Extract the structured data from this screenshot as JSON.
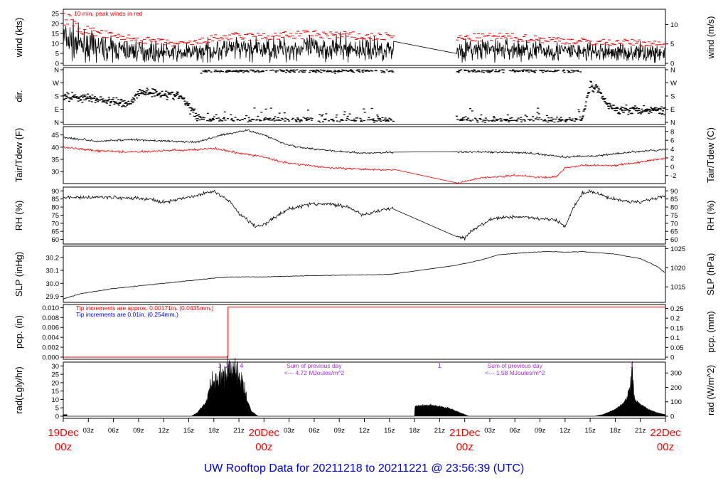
{
  "chart_data": [
    {
      "id": "wind",
      "type": "line",
      "ylabel": "wind (kts)",
      "ylabel_right": "wind (m/s)",
      "ylim": [
        0,
        26
      ],
      "yticks": [
        0,
        5,
        10,
        15,
        20,
        25
      ],
      "yticks_right": [
        0,
        5,
        10
      ],
      "right_scale": 0.5144,
      "annotation": "10 min. peak winds in red",
      "series_color": "#000000",
      "peak_color": "#ff0000",
      "gap_hours": [
        39.5,
        47
      ],
      "avg": [
        [
          0,
          12
        ],
        [
          1,
          11
        ],
        [
          2,
          9
        ],
        [
          4,
          8
        ],
        [
          6,
          7
        ],
        [
          8,
          6.5
        ],
        [
          10,
          6
        ],
        [
          12,
          5.5
        ],
        [
          14,
          5
        ],
        [
          16,
          5.5
        ],
        [
          18,
          6.5
        ],
        [
          20,
          7
        ],
        [
          24,
          7
        ],
        [
          28,
          7.5
        ],
        [
          32,
          7.5
        ],
        [
          36,
          7
        ],
        [
          39.5,
          7
        ],
        [
          47,
          6.5
        ],
        [
          52,
          7
        ],
        [
          56,
          6.5
        ],
        [
          60,
          6
        ],
        [
          64,
          5.5
        ],
        [
          68,
          5.5
        ],
        [
          72,
          5
        ]
      ]
    },
    {
      "id": "dir",
      "type": "scatter",
      "ylabel": "dir.",
      "ytick_labels": [
        "N",
        "E",
        "S",
        "W",
        "N"
      ],
      "ylim": [
        0,
        360
      ],
      "values": [
        [
          0,
          180
        ],
        [
          4,
          160
        ],
        [
          6,
          140
        ],
        [
          8,
          130
        ],
        [
          9,
          200
        ],
        [
          10,
          210
        ],
        [
          12,
          195
        ],
        [
          14,
          180
        ],
        [
          15,
          110
        ],
        [
          16,
          40
        ],
        [
          17,
          10
        ],
        [
          62,
          10
        ],
        [
          63,
          260
        ],
        [
          64,
          220
        ],
        [
          65,
          120
        ],
        [
          66,
          90
        ],
        [
          72,
          85
        ]
      ]
    },
    {
      "id": "temp",
      "type": "line",
      "ylabel": "Tair/Tdew (F)",
      "ylabel_right": "Tair/Tdew (C)",
      "ylim": [
        26,
        47.5
      ],
      "yticks": [
        30,
        35,
        40,
        45
      ],
      "yticks_right": [
        -2,
        0,
        2,
        4,
        6,
        8
      ],
      "series": [
        {
          "name": "Tair",
          "color": "#000000",
          "values": [
            [
              0,
              44
            ],
            [
              4,
              42.5
            ],
            [
              8,
              43
            ],
            [
              12,
              42.5
            ],
            [
              16,
              42
            ],
            [
              19,
              45
            ],
            [
              22,
              47
            ],
            [
              24,
              45
            ],
            [
              26,
              42
            ],
            [
              28,
              40
            ],
            [
              32,
              38.5
            ],
            [
              36,
              37.5
            ],
            [
              40,
              38
            ],
            [
              48,
              38
            ],
            [
              52,
              38
            ],
            [
              56,
              37.5
            ],
            [
              60,
              36
            ],
            [
              64,
              36.5
            ],
            [
              68,
              38
            ],
            [
              72,
              39
            ]
          ]
        },
        {
          "name": "Tdew",
          "color": "#ff0000",
          "values": [
            [
              0,
              40
            ],
            [
              4,
              38.5
            ],
            [
              8,
              38
            ],
            [
              12,
              38.5
            ],
            [
              16,
              39
            ],
            [
              18,
              39.5
            ],
            [
              21,
              37.5
            ],
            [
              24,
              36
            ],
            [
              26,
              34
            ],
            [
              28,
              33
            ],
            [
              32,
              31.5
            ],
            [
              36,
              31
            ],
            [
              40,
              30.5
            ],
            [
              44,
              30
            ],
            [
              45.5,
              28.5
            ],
            [
              47,
              25
            ],
            [
              48,
              26
            ],
            [
              50,
              27.5
            ],
            [
              54,
              28.5
            ],
            [
              58,
              27.5
            ],
            [
              59,
              28
            ],
            [
              60,
              31.5
            ],
            [
              62,
              32.5
            ],
            [
              66,
              32.5
            ],
            [
              68,
              33.5
            ],
            [
              72,
              35.5
            ]
          ]
        }
      ]
    },
    {
      "id": "rh",
      "type": "line",
      "ylabel": "RH (%)",
      "ylabel_right": "RH (%)",
      "ylim": [
        58.5,
        91
      ],
      "yticks": [
        60,
        65,
        70,
        75,
        80,
        85,
        90
      ],
      "values": [
        [
          0,
          86
        ],
        [
          6,
          86
        ],
        [
          10,
          85
        ],
        [
          12,
          83
        ],
        [
          16,
          87
        ],
        [
          18,
          90
        ],
        [
          20,
          83
        ],
        [
          21,
          76
        ],
        [
          22,
          72
        ],
        [
          23,
          68
        ],
        [
          24,
          69
        ],
        [
          25,
          73
        ],
        [
          27,
          79
        ],
        [
          30,
          82
        ],
        [
          32,
          82
        ],
        [
          34,
          80
        ],
        [
          36,
          75
        ],
        [
          38,
          78
        ],
        [
          40,
          80
        ],
        [
          42,
          78
        ],
        [
          45,
          76
        ],
        [
          46,
          72
        ],
        [
          47,
          62
        ],
        [
          48,
          61
        ],
        [
          49,
          66
        ],
        [
          51,
          72
        ],
        [
          53,
          74
        ],
        [
          55,
          74
        ],
        [
          57,
          73
        ],
        [
          59,
          72
        ],
        [
          60,
          68
        ],
        [
          61,
          80
        ],
        [
          62,
          88
        ],
        [
          63,
          90
        ],
        [
          65,
          86
        ],
        [
          67,
          84
        ],
        [
          69,
          83
        ],
        [
          72,
          87
        ]
      ]
    },
    {
      "id": "slp",
      "type": "line",
      "ylabel": "SLP (inHg)",
      "ylabel_right": "SLP (hPa)",
      "ylim": [
        29.87,
        30.27
      ],
      "yticks": [
        29.9,
        30.0,
        30.1,
        30.2
      ],
      "yticks_right": [
        1015,
        1020,
        1025
      ],
      "values": [
        [
          0,
          29.88
        ],
        [
          2,
          29.92
        ],
        [
          6,
          29.96
        ],
        [
          12,
          30.0
        ],
        [
          18,
          30.04
        ],
        [
          20,
          30.05
        ],
        [
          24,
          30.05
        ],
        [
          30,
          30.06
        ],
        [
          36,
          30.065
        ],
        [
          39.5,
          30.07
        ],
        [
          47,
          30.14
        ],
        [
          50,
          30.18
        ],
        [
          52,
          30.22
        ],
        [
          56,
          30.24
        ],
        [
          58,
          30.245
        ],
        [
          60,
          30.24
        ],
        [
          62,
          30.245
        ],
        [
          66,
          30.225
        ],
        [
          69,
          30.19
        ],
        [
          71,
          30.13
        ],
        [
          72,
          30.08
        ]
      ]
    },
    {
      "id": "pcp",
      "type": "line",
      "ylabel": "pcp. (in)",
      "ylabel_right": "pcp. (mm)",
      "ylim": [
        0,
        0.0102
      ],
      "yticks": [
        0.0,
        0.002,
        0.004,
        0.006,
        0.008,
        0.01
      ],
      "ytick_labels": [
        "0.000",
        "0.002",
        "0.004",
        "0.006",
        "0.008",
        "0.010"
      ],
      "yticks_right": [
        0,
        0.05,
        0.1,
        0.15,
        0.2,
        0.25
      ],
      "notes": [
        {
          "text": "Tip increments are approx. 0.00171in. (0.0435mm.)",
          "color": "#ff0000"
        },
        {
          "text": "Tip increments are 0.01in. (0.254mm.)",
          "color": "#0000ff"
        }
      ],
      "values": [
        [
          0,
          0
        ],
        [
          19.7,
          0
        ],
        [
          19.7,
          0.0101
        ],
        [
          72,
          0.0101
        ]
      ],
      "color": "#ff0000"
    },
    {
      "id": "rad",
      "type": "area",
      "ylabel": "rad(Lgly/hr)",
      "ylabel_right": "rad (W/m^2)",
      "ylim": [
        0,
        31
      ],
      "yticks": [
        0,
        5,
        10,
        15,
        20,
        25,
        30
      ],
      "yticks_right": [
        0,
        100,
        200,
        300
      ],
      "day_notes": [
        {
          "hour": 30,
          "lines": [
            "Sum of previous day",
            "<--- 4.72 MJoules/m^2"
          ]
        },
        {
          "hour": 54,
          "lines": [
            "Sum of previous day",
            "<--- 1.58 MJoules/m^2"
          ]
        }
      ],
      "markers": [
        {
          "hour": 18.7,
          "label": "1"
        },
        {
          "hour": 19.6,
          "label": "2"
        },
        {
          "hour": 21.3,
          "label": "4"
        },
        {
          "hour": 45,
          "label": "1"
        },
        {
          "hour": 68,
          "label": "1"
        }
      ],
      "values": [
        [
          0,
          1
        ],
        [
          0.4,
          1
        ],
        [
          0.5,
          0
        ],
        [
          15.3,
          0
        ],
        [
          16,
          2
        ],
        [
          17,
          8
        ],
        [
          17.7,
          17
        ],
        [
          18.5,
          22
        ],
        [
          19.5,
          26
        ],
        [
          20,
          29
        ],
        [
          20.7,
          27
        ],
        [
          21.3,
          22
        ],
        [
          21.8,
          12
        ],
        [
          22.5,
          3
        ],
        [
          23.3,
          0
        ],
        [
          42,
          0
        ],
        [
          42.05,
          6
        ],
        [
          44,
          6.5
        ],
        [
          46,
          5
        ],
        [
          47.5,
          2
        ],
        [
          48.5,
          0
        ],
        [
          63.5,
          0
        ],
        [
          64.5,
          1
        ],
        [
          66,
          4
        ],
        [
          67,
          8
        ],
        [
          67.6,
          12
        ],
        [
          68,
          24
        ],
        [
          68.3,
          10
        ],
        [
          69,
          7
        ],
        [
          70,
          4
        ],
        [
          71,
          2
        ],
        [
          72,
          1
        ]
      ]
    }
  ],
  "xaxis": {
    "hour_labels": [
      "03z",
      "06z",
      "09z",
      "12z",
      "15z",
      "18z",
      "21z"
    ],
    "days": [
      {
        "date": "19Dec",
        "time": "00z"
      },
      {
        "date": "20Dec",
        "time": "00z"
      },
      {
        "date": "21Dec",
        "time": "00z"
      },
      {
        "date": "22Dec",
        "time": "00z"
      }
    ],
    "range_hours": [
      0,
      72
    ],
    "day_color": "#ff0000"
  },
  "title": "UW Rooftop Data for 20211218  to  20211221 @ 23:56:39  (UTC)"
}
